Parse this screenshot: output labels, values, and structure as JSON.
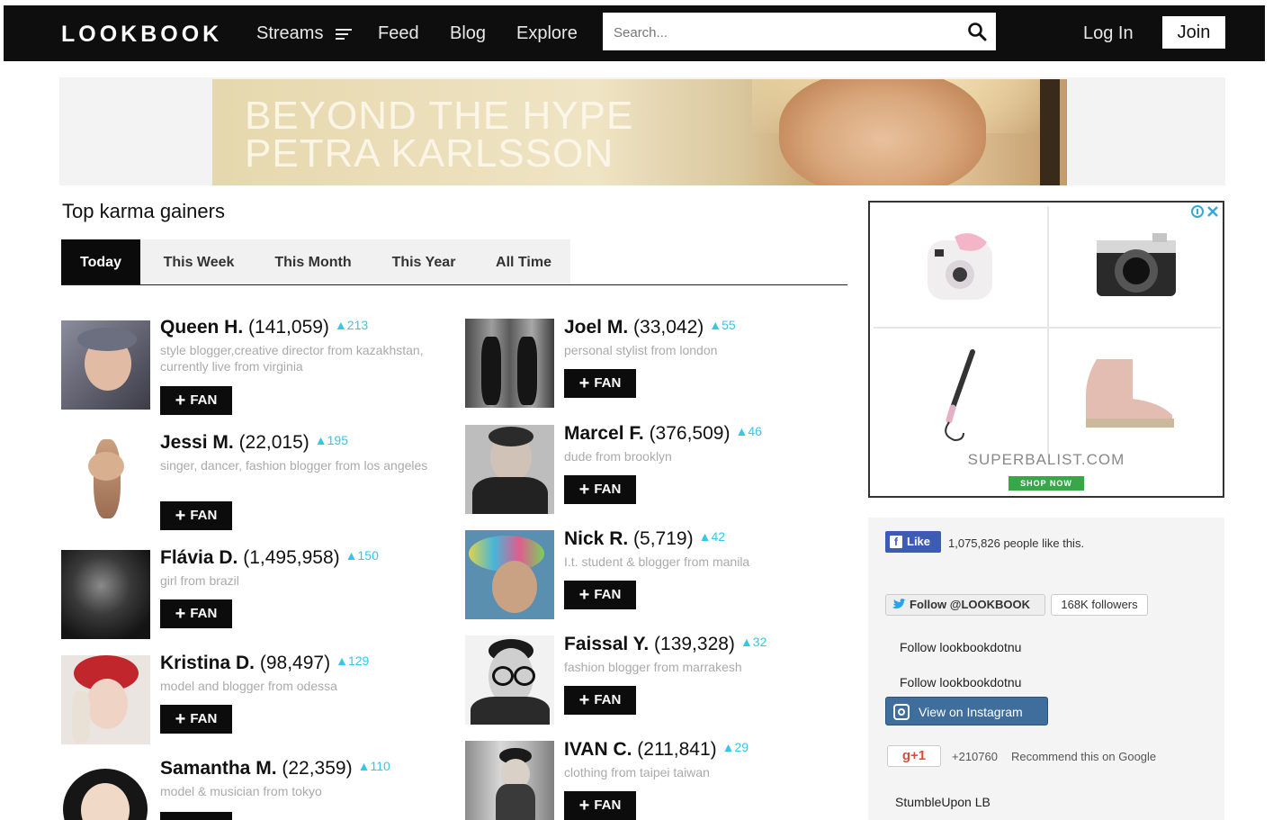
{
  "nav": {
    "logo": "LOOKBOOK",
    "streams": "Streams",
    "feed": "Feed",
    "blog": "Blog",
    "explore": "Explore",
    "search_placeholder": "Search...",
    "login": "Log In",
    "join": "Join",
    "bg_color": "#0e0e0e"
  },
  "banner": {
    "line1": "Beyond the hype",
    "line2": "Petra Karlsson"
  },
  "section_title": "Top karma gainers",
  "tabs": [
    {
      "label": "Today",
      "active": true
    },
    {
      "label": "This Week",
      "active": false
    },
    {
      "label": "This Month",
      "active": false
    },
    {
      "label": "This Year",
      "active": false
    },
    {
      "label": "All Time",
      "active": false
    }
  ],
  "fan_label": "FAN",
  "accent_color": "#35c6e8",
  "gainers_left": [
    {
      "name": "Queen H.",
      "karma": "(141,059)",
      "delta": "▲213",
      "bio": "style blogger,creative director from kazakhstan, currently live from virginia"
    },
    {
      "name": "Jessi M.",
      "karma": "(22,015)",
      "delta": "▲195",
      "bio": "singer, dancer, fashion blogger from los angeles"
    },
    {
      "name": "Flávia D.",
      "karma": "(1,495,958)",
      "delta": "▲150",
      "bio": "girl from brazil"
    },
    {
      "name": "Kristina D.",
      "karma": "(98,497)",
      "delta": "▲129",
      "bio": "model and blogger from odessa"
    },
    {
      "name": "Samantha M.",
      "karma": "(22,359)",
      "delta": "▲110",
      "bio": "model & musician from tokyo"
    }
  ],
  "gainers_right": [
    {
      "name": "Joel M.",
      "karma": "(33,042)",
      "delta": "▲55",
      "bio": "personal stylist from london"
    },
    {
      "name": "Marcel F.",
      "karma": "(376,509)",
      "delta": "▲46",
      "bio": "dude from brooklyn"
    },
    {
      "name": "Nick R.",
      "karma": "(5,719)",
      "delta": "▲42",
      "bio": "I.t. student & blogger from manila"
    },
    {
      "name": "Faissal Y.",
      "karma": "(139,328)",
      "delta": "▲32",
      "bio": "fashion blogger from marrakesh"
    },
    {
      "name": "IVAN C.",
      "karma": "(211,841)",
      "delta": "▲29",
      "bio": "clothing from taipei taiwan"
    }
  ],
  "ad": {
    "brand": "SUPERBALIST.COM",
    "cta": "SHOP NOW"
  },
  "social": {
    "fb_like": "Like",
    "fb_text": "1,075,826 people like this.",
    "tw_follow": "Follow @LOOKBOOK",
    "tw_count": "168K followers",
    "follow1": "Follow lookbookdotnu",
    "follow2": "Follow lookbookdotnu",
    "ig_button": "View on Instagram",
    "gplus": "g+1",
    "gplus_count": "+210760",
    "gplus_text": "Recommend this on Google",
    "stumble": "StumbleUpon LB"
  }
}
